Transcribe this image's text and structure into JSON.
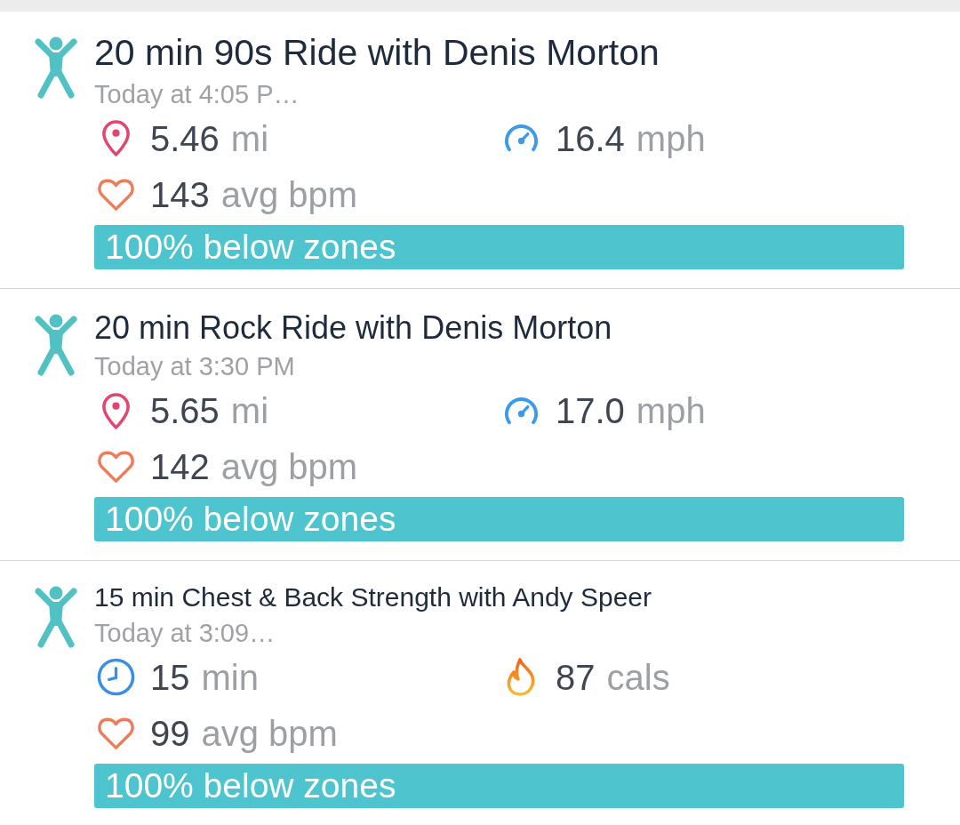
{
  "activities": [
    {
      "title": "20 min 90s Ride with Denis Morton",
      "time": "Today at 4:05 P…",
      "stats": [
        {
          "kind": "distance",
          "value": "5.46",
          "unit": "mi"
        },
        {
          "kind": "speed",
          "value": "16.4",
          "unit": "mph"
        },
        {
          "kind": "heart_rate",
          "value": "143",
          "unit": "avg bpm"
        }
      ],
      "zone_summary": "100% below zones"
    },
    {
      "title": "20 min Rock Ride with Denis Morton",
      "time": "Today at 3:30 PM",
      "stats": [
        {
          "kind": "distance",
          "value": "5.65",
          "unit": "mi"
        },
        {
          "kind": "speed",
          "value": "17.0",
          "unit": "mph"
        },
        {
          "kind": "heart_rate",
          "value": "142",
          "unit": "avg bpm"
        }
      ],
      "zone_summary": "100% below zones"
    },
    {
      "title": "15 min Chest & Back Strength with Andy Speer",
      "time": "Today at 3:09…",
      "stats": [
        {
          "kind": "duration",
          "value": "15",
          "unit": "min"
        },
        {
          "kind": "calories",
          "value": "87",
          "unit": "cals"
        },
        {
          "kind": "heart_rate",
          "value": "99",
          "unit": "avg bpm"
        }
      ],
      "zone_summary": "100% below zones"
    }
  ]
}
